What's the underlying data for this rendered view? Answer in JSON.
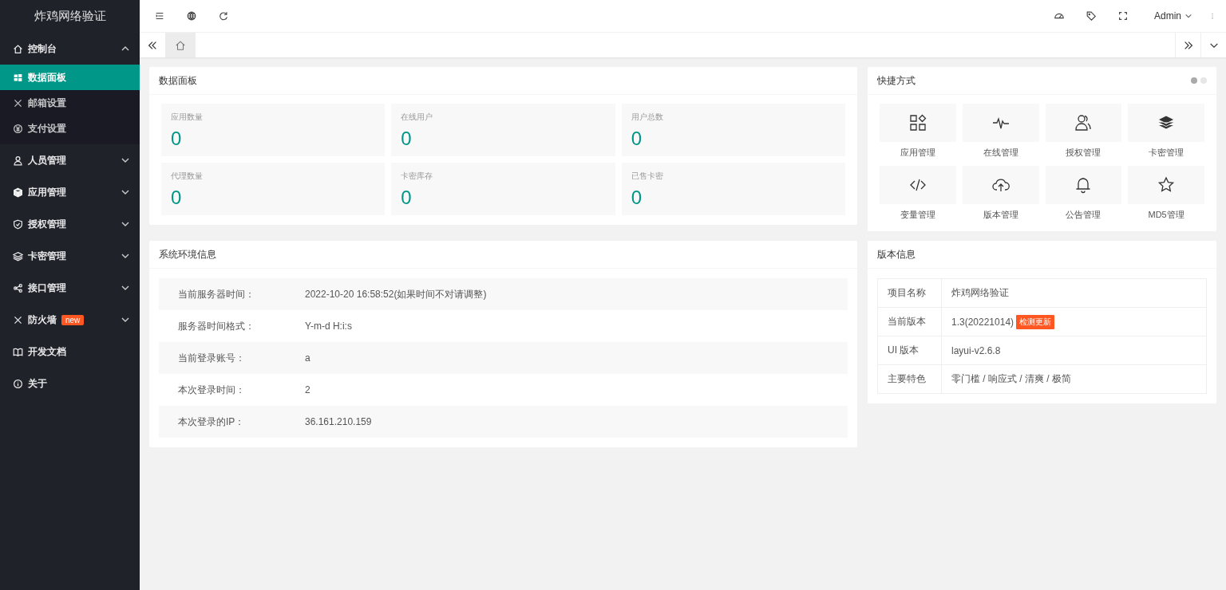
{
  "sidebar": {
    "title": "炸鸡网络验证",
    "items": [
      {
        "label": "控制台",
        "expanded": true,
        "children": [
          {
            "label": "数据面板",
            "selected": true
          },
          {
            "label": "邮箱设置",
            "selected": false
          },
          {
            "label": "支付设置",
            "selected": false
          }
        ]
      },
      {
        "label": "人员管理",
        "expanded": false
      },
      {
        "label": "应用管理",
        "expanded": false
      },
      {
        "label": "授权管理",
        "expanded": false
      },
      {
        "label": "卡密管理",
        "expanded": false
      },
      {
        "label": "接口管理",
        "expanded": false
      },
      {
        "label": "防火墙",
        "badge": "new",
        "expanded": false
      },
      {
        "label": "开发文档"
      },
      {
        "label": "关于"
      }
    ]
  },
  "topbar": {
    "user": "Admin"
  },
  "tabs": [
    {
      "kind": "home",
      "selected": true
    }
  ],
  "stats": {
    "title": "数据面板",
    "items": [
      {
        "label": "应用数量",
        "value": "0"
      },
      {
        "label": "在线用户",
        "value": "0"
      },
      {
        "label": "用户总数",
        "value": "0"
      },
      {
        "label": "代理数量",
        "value": "0"
      },
      {
        "label": "卡密库存",
        "value": "0"
      },
      {
        "label": "已售卡密",
        "value": "0"
      }
    ]
  },
  "shortcuts": {
    "title": "快捷方式",
    "pages": [
      {
        "selected": true
      },
      {
        "selected": false
      }
    ],
    "items": [
      {
        "label": "应用管理"
      },
      {
        "label": "在线管理"
      },
      {
        "label": "授权管理"
      },
      {
        "label": "卡密管理"
      },
      {
        "label": "变量管理"
      },
      {
        "label": "版本管理"
      },
      {
        "label": "公告管理"
      },
      {
        "label": "MD5管理"
      }
    ]
  },
  "system_info": {
    "title": "系统环境信息",
    "rows": [
      {
        "label": "当前服务器时间：",
        "value": "2022-10-20 16:58:52(如果时间不对请调整)"
      },
      {
        "label": "服务器时间格式：",
        "value": "Y-m-d H:i:s"
      },
      {
        "label": "当前登录账号：",
        "value": "a"
      },
      {
        "label": "本次登录时间：",
        "value": "2"
      },
      {
        "label": "本次登录的IP：",
        "value": "36.161.210.159"
      }
    ]
  },
  "version_info": {
    "title": "版本信息",
    "rows": [
      {
        "label": "项目名称",
        "value": "炸鸡网络验证"
      },
      {
        "label": "当前版本",
        "value": "1.3(20221014)",
        "badge": "检测更新"
      },
      {
        "label": "UI 版本",
        "value": "layui-v2.6.8"
      },
      {
        "label": "主要特色",
        "value": "零门槛 / 响应式 / 清爽 / 极简"
      }
    ]
  }
}
